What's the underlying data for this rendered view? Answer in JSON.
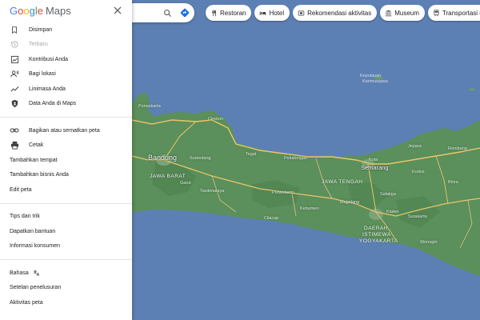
{
  "logo": {
    "google": [
      "G",
      "o",
      "o",
      "g",
      "l",
      "e"
    ],
    "maps": "Maps"
  },
  "sidebar": {
    "section1": [
      {
        "label": "Disimpan",
        "icon": "bookmark-icon",
        "disabled": false
      },
      {
        "label": "Terbaru",
        "icon": "history-icon",
        "disabled": true
      },
      {
        "label": "Kontribusi Anda",
        "icon": "contributions-icon",
        "disabled": false
      },
      {
        "label": "Bagi lokasi",
        "icon": "location-sharing-icon",
        "disabled": false
      },
      {
        "label": "Linimasa Anda",
        "icon": "timeline-icon",
        "disabled": false
      },
      {
        "label": "Data Anda di Maps",
        "icon": "shield-icon",
        "disabled": false
      }
    ],
    "section2": [
      {
        "label": "Bagikan atau sematkan peta",
        "icon": "link-icon"
      },
      {
        "label": "Cetak",
        "icon": "print-icon"
      },
      {
        "label": "Tambahkan tempat"
      },
      {
        "label": "Tambahkan bisnis Anda"
      },
      {
        "label": "Edit peta"
      }
    ],
    "section3": [
      {
        "label": "Tips dan trik"
      },
      {
        "label": "Dapatkan bantuan"
      },
      {
        "label": "Informasi konsumen"
      }
    ],
    "section4": [
      {
        "label": "Bahasa",
        "icon": "translate-icon"
      },
      {
        "label": "Setelan penelusuran"
      },
      {
        "label": "Aktivitas peta"
      }
    ]
  },
  "chips": [
    {
      "label": "Restoran",
      "icon": "restaurant-icon"
    },
    {
      "label": "Hotel",
      "icon": "hotel-icon"
    },
    {
      "label": "Rekomendasi aktivitas",
      "icon": "attractions-icon"
    },
    {
      "label": "Museum",
      "icon": "museum-icon"
    },
    {
      "label": "Transportasi umum",
      "icon": "transit-icon"
    }
  ],
  "map_labels": {
    "bandung": "Bandung",
    "semarang": "Semarang",
    "jawa_barat": "JAWA BARAT",
    "jawa_tengah": "JAWA TENGAH",
    "daerah": "DAERAH",
    "istimewa": "ISTIMEWA",
    "yogyakarta": "YOGYAKARTA",
    "kota": "Kota",
    "semarang2": "Semarang",
    "purwakarta": "Purwakarta",
    "sumedang": "Sumedang",
    "garut": "Garut",
    "tasikmalaya": "Tasikmalaya",
    "cirebon": "Cirebon",
    "tegal": "Tegal",
    "pekalongan": "Pekalongan",
    "purwokerto": "Purwokerto",
    "cilacap": "Cilacap",
    "kebumen": "Kebumen",
    "magelang": "Magelang",
    "salatiga": "Salatiga",
    "kudus": "Kudus",
    "jepara": "Jepara",
    "rembang": "Rembang",
    "blora": "Blora",
    "surakarta": "Surakarta",
    "klaten": "Klaten",
    "wonogiri": "Wonogiri",
    "kepulauan": "Kepulauan",
    "karimunjawa": "Karimunjawa"
  },
  "colors": {
    "land": "#5b8f5b",
    "sea": "#5d80b4",
    "road": "#e8c76a"
  }
}
